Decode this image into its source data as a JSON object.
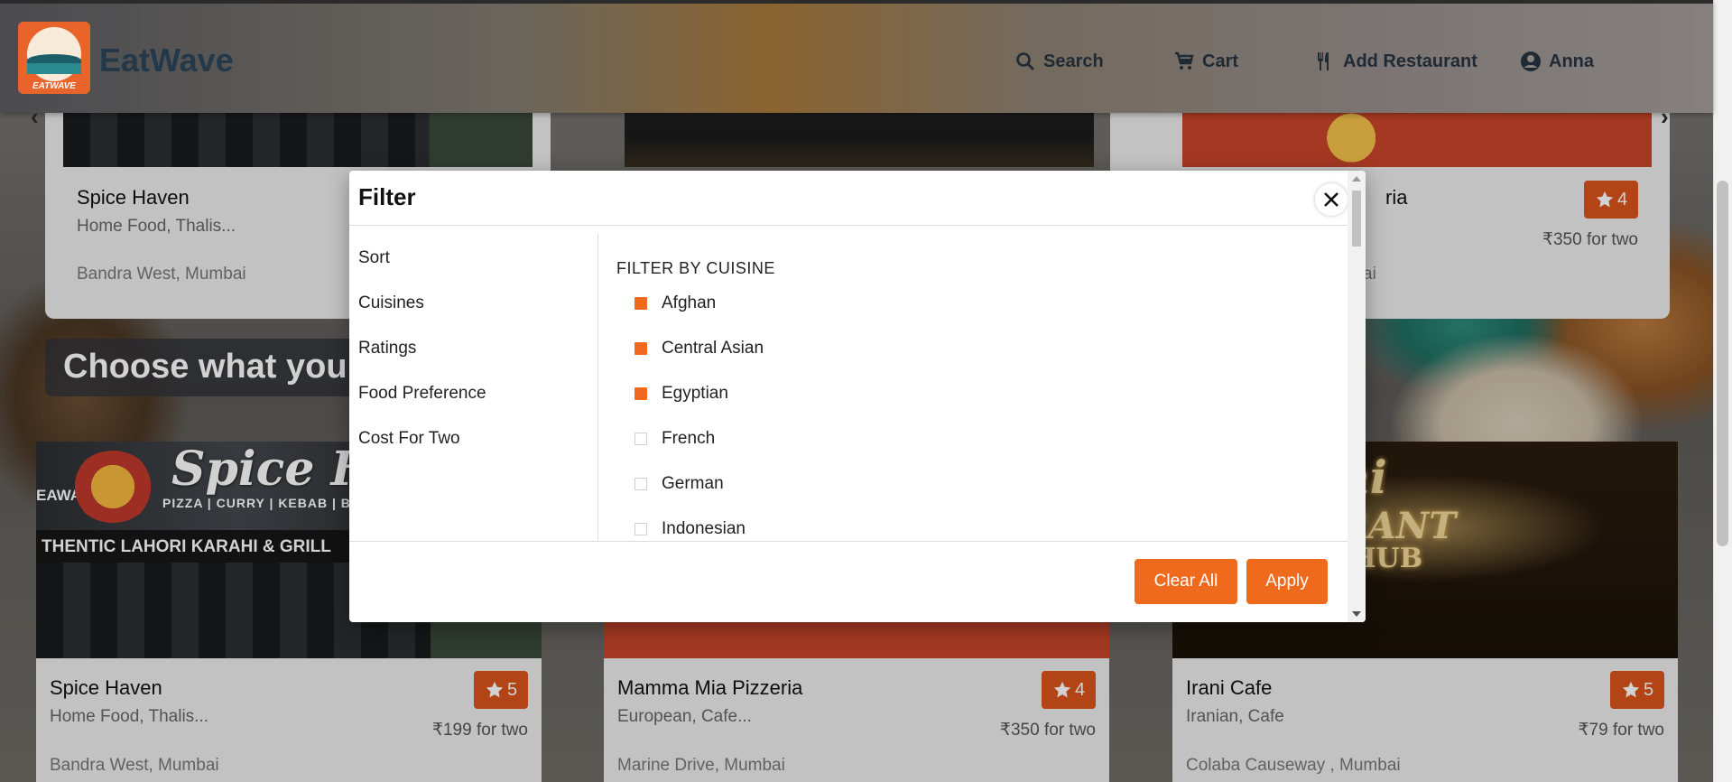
{
  "header": {
    "logo_text": "EATWAVE",
    "brand": "EatWave",
    "nav": {
      "search": "Search",
      "cart": "Cart",
      "add_restaurant": "Add Restaurant",
      "user": "Anna"
    }
  },
  "top_cards": [
    {
      "name": "Spice Haven",
      "cuisines": "Home Food, Thalis...",
      "location": "Bandra West, Mumbai"
    },
    {
      "name_partial": "ria",
      "rating": "4",
      "price": "₹350 for two",
      "location_partial": "ai"
    }
  ],
  "section_title": "Choose what you",
  "cards": [
    {
      "name": "Spice Haven",
      "cuisines": "Home Food, Thalis...",
      "price": "₹199 for two",
      "location": "Bandra West, Mumbai",
      "rating": "5",
      "sign_text": "Spice Ha",
      "sign_menu": "PIZZA | CURRY | KEBAB | B",
      "sign_strip": "THENTIC LAHORI KARAHI & GRILL",
      "sign_left": "EAWAY"
    },
    {
      "name": "Mamma Mia Pizzeria",
      "cuisines": "European, Cafe...",
      "price": "₹350 for two",
      "location": "Marine Drive, Mumbai",
      "rating": "4"
    },
    {
      "name": "Irani Cafe",
      "cuisines": "Iranian, Cafe",
      "price": "₹79 for two",
      "location": "Colaba Causeway , Mumbai",
      "rating": "5",
      "sign_top": "ani",
      "sign_mid": "TAURANT",
      "sign_bot": "CE HUB"
    }
  ],
  "modal": {
    "title": "Filter",
    "sidebar": [
      "Sort",
      "Cuisines",
      "Ratings",
      "Food Preference",
      "Cost For Two"
    ],
    "heading": "FILTER BY CUISINE",
    "cuisines": [
      {
        "label": "Afghan",
        "checked": true
      },
      {
        "label": "Central Asian",
        "checked": true
      },
      {
        "label": "Egyptian",
        "checked": true
      },
      {
        "label": "French",
        "checked": false
      },
      {
        "label": "German",
        "checked": false
      },
      {
        "label": "Indonesian",
        "checked": false
      }
    ],
    "clear_label": "Clear All",
    "apply_label": "Apply"
  },
  "colors": {
    "accent": "#f06a1d",
    "rating_bg": "#d9541c",
    "brand_text": "#233848"
  }
}
